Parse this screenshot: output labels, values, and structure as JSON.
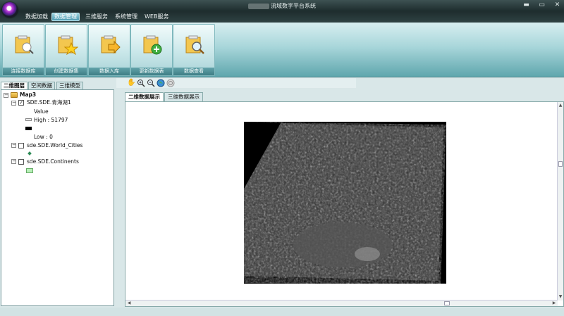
{
  "window": {
    "title": "流域数字平台系统",
    "controls": {
      "minimize": "▬",
      "restore": "▭",
      "close": "✕"
    }
  },
  "menu": {
    "items": [
      {
        "label": "数据加载"
      },
      {
        "label": "数据管理"
      },
      {
        "label": "三维服务"
      },
      {
        "label": "系统管理"
      },
      {
        "label": "WEB服务"
      }
    ],
    "active": "数据管理"
  },
  "ribbon": {
    "buttons": [
      {
        "label": "连接数据库",
        "icon": "database-connect-icon"
      },
      {
        "label": "创建数据集",
        "icon": "dataset-create-icon"
      },
      {
        "label": "数据入库",
        "icon": "data-import-icon"
      },
      {
        "label": "更新数据表",
        "icon": "table-update-icon"
      },
      {
        "label": "数据查看",
        "icon": "data-view-icon"
      }
    ]
  },
  "toolbar": {
    "tools": [
      "pan-hand-icon",
      "zoom-in-icon",
      "zoom-out-icon",
      "globe-full-extent-icon",
      "refresh-icon"
    ]
  },
  "left": {
    "tabs": [
      {
        "label": "二维图层"
      },
      {
        "label": "空间数据"
      },
      {
        "label": "三维模型"
      }
    ],
    "tree": {
      "map": "Map3",
      "layers": [
        {
          "name": "SDE.SDE.青海湖1",
          "checked": true,
          "legend": [
            "Value",
            "High : 51797",
            "Low : 0"
          ]
        },
        {
          "name": "sde.SDE.World_Cities",
          "checked": false
        },
        {
          "name": "sde.SDE.Continents",
          "checked": false
        }
      ]
    }
  },
  "right": {
    "tabs": [
      {
        "label": "二维数据展示"
      },
      {
        "label": "三维数据展示"
      }
    ]
  },
  "colors": {
    "titlebar": "#1d2c2d",
    "ribbon_top": "#d7eef0",
    "ribbon_bottom": "#5fa6ad",
    "raster_bg": "#000000"
  }
}
